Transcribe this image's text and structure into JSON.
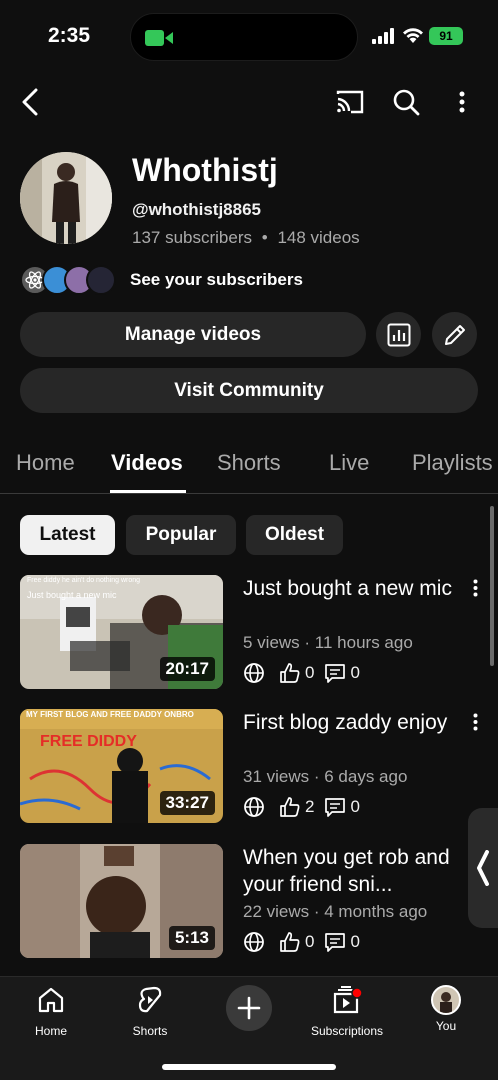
{
  "status_bar": {
    "time": "2:35",
    "battery": "91"
  },
  "channel": {
    "name": "Whothistj",
    "handle": "@whothistj8865",
    "subscribers": "137 subscribers",
    "separator": "•",
    "videos": "148 videos",
    "see_subscribers": "See your subscribers"
  },
  "actions": {
    "manage_videos": "Manage videos",
    "visit_community": "Visit Community"
  },
  "tabs": [
    "Home",
    "Videos",
    "Shorts",
    "Live",
    "Playlists"
  ],
  "filters": [
    "Latest",
    "Popular",
    "Oldest"
  ],
  "videos": [
    {
      "title": "Just bought a new mic",
      "meta": "5 views · 11 hours ago",
      "duration": "20:17",
      "likes": "0",
      "comments": "0",
      "thumb_caption_1": "Free diddy he ain't do nothing wrong",
      "thumb_caption_2": "Just bought a new mic"
    },
    {
      "title": "First blog zaddy enjoy",
      "meta": "31 views · 6 days ago",
      "duration": "33:27",
      "likes": "2",
      "comments": "0",
      "thumb_caption_1": "MY FIRST BLOG AND FREE DADDY ONBRO",
      "thumb_caption_2": "FREE DIDDY"
    },
    {
      "title": "When you get rob and your friend sni...",
      "meta": "22 views · 4 months ago",
      "duration": "5:13",
      "likes": "0",
      "comments": "0"
    }
  ],
  "bottom_nav": {
    "home": "Home",
    "shorts": "Shorts",
    "subscriptions": "Subscriptions",
    "you": "You"
  },
  "colors": {
    "background": "#0f0f0f",
    "surface": "#272727",
    "text_secondary": "#aaaaaa",
    "notification_dot": "#ff0000",
    "battery": "#34c759"
  }
}
